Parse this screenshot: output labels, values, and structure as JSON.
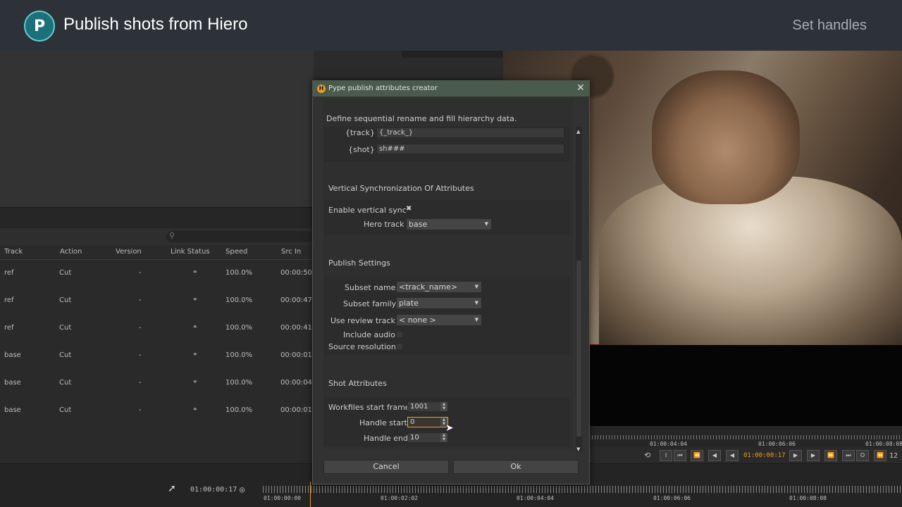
{
  "banner": {
    "logo_letter": "P",
    "title": "Publish shots from Hiero",
    "right_label": "Set handles"
  },
  "table": {
    "headers": [
      "Track",
      "Action",
      "Version",
      "Link Status",
      "Speed",
      "Src In"
    ],
    "rows": [
      {
        "track": "ref",
        "action": "Cut",
        "version": "-",
        "link": "⚭",
        "speed": "100.0%",
        "src_in": "00:00:50:"
      },
      {
        "track": "ref",
        "action": "Cut",
        "version": "-",
        "link": "⚭",
        "speed": "100.0%",
        "src_in": "00:00:47:"
      },
      {
        "track": "ref",
        "action": "Cut",
        "version": "-",
        "link": "⚭",
        "speed": "100.0%",
        "src_in": "00:00:41:"
      },
      {
        "track": "base",
        "action": "Cut",
        "version": "-",
        "link": "⚭",
        "speed": "100.0%",
        "src_in": "00:00:01:"
      },
      {
        "track": "base",
        "action": "Cut",
        "version": "-",
        "link": "⚭",
        "speed": "100.0%",
        "src_in": "00:00:04:"
      },
      {
        "track": "base",
        "action": "Cut",
        "version": "-",
        "link": "⚭",
        "speed": "100.0%",
        "src_in": "00:00:01:"
      }
    ]
  },
  "viewer": {
    "ruler_tc": [
      "01:00:04:04",
      "01:00:06:06",
      "01:00:08:08"
    ],
    "current_tc": "01:00:00:17",
    "frame_field": "12"
  },
  "bottom_timeline": {
    "current_tc": "01:00:00:17",
    "ruler_tc": [
      "01:00:00:00",
      "01:00:02:02",
      "01:00:04:04",
      "01:00:06:06",
      "01:00:08:08"
    ]
  },
  "dialog": {
    "title": "Pype publish attributes creator",
    "intro": "Define sequential rename and fill hierarchy data.",
    "track_label": "{track}",
    "track_value": "{_track_}",
    "shot_label": "{shot}",
    "shot_value": "sh###",
    "vsync_section": "Vertical Synchronization Of Attributes",
    "vsync_label": "Enable vertical sync",
    "vsync_mark": "✖",
    "hero_track_label": "Hero track",
    "hero_track_value": "base",
    "publish_section": "Publish Settings",
    "subset_name_label": "Subset name",
    "subset_name_value": "<track_name>",
    "subset_family_label": "Subset family",
    "subset_family_value": "plate",
    "review_track_label": "Use review track",
    "review_track_value": "< none >",
    "include_audio_label": "Include audio",
    "source_resolution_label": "Source resolution",
    "shot_section": "Shot Attributes",
    "workfiles_label": "Workfiles start frame",
    "workfiles_value": "1001",
    "handle_start_label": "Handle start",
    "handle_start_value": "0",
    "handle_end_label": "Handle end",
    "handle_end_value": "10",
    "cancel": "Cancel",
    "ok": "Ok"
  }
}
